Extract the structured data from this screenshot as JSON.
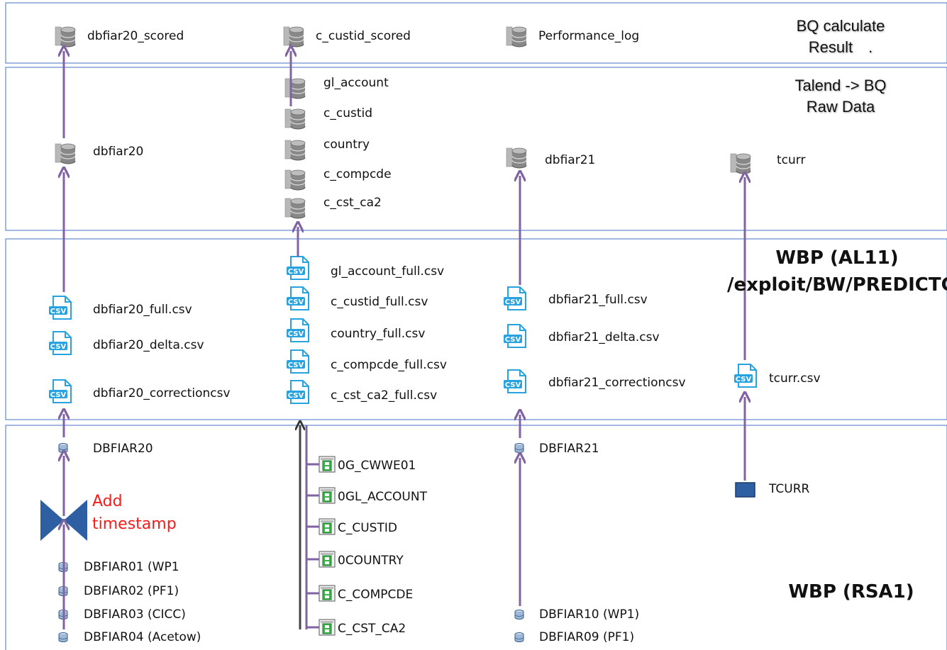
{
  "zones": {
    "bq_result": {
      "line1": "BQ calculate",
      "line2": "Result",
      "dot": "."
    },
    "bq_raw": {
      "line1": "Talend -> BQ",
      "line2": "Raw Data"
    },
    "al11": {
      "line1": "WBP (AL11)",
      "line2": "/exploit/BW/PREDICTCM"
    },
    "rsa1": {
      "line1": "WBP (RSA1)"
    }
  },
  "annotation": {
    "line1": "Add",
    "line2": "timestamp"
  },
  "bq_scored": [
    "dbfiar20_scored",
    "c_custid_scored",
    "Performance_log"
  ],
  "bq_raw_tables": {
    "col1": [
      "dbfiar20"
    ],
    "col2": [
      "gl_account",
      "c_custid",
      "country",
      "c_compcde",
      "c_cst_ca2"
    ],
    "col3": [
      "dbfiar21"
    ],
    "col4": [
      "tcurr"
    ]
  },
  "csv_files": {
    "col1": [
      "dbfiar20_full.csv",
      "dbfiar20_delta.csv",
      "dbfiar20_correctioncsv"
    ],
    "col2": [
      "gl_account_full.csv",
      "c_custid_full.csv",
      "country_full.csv",
      "c_compcde_full.csv",
      "c_cst_ca2_full.csv"
    ],
    "col3": [
      "dbfiar21_full.csv",
      "dbfiar21_delta.csv",
      "dbfiar21_correctioncsv"
    ],
    "col4": [
      "tcurr.csv"
    ]
  },
  "rsa1_sources": {
    "col1_top": "DBFIAR20",
    "col1_bottom": [
      "DBFIAR01 (WP1",
      "DBFIAR02 (PF1)",
      "DBFIAR03 (CICC)",
      "DBFIAR04 (Acetow)"
    ],
    "col2": [
      "0G_CWWE01",
      "0GL_ACCOUNT",
      "C_CUSTID",
      "0COUNTRY",
      "C_COMPCDE",
      "C_CST_CA2"
    ],
    "col3_top": "DBFIAR21",
    "col3_bottom": [
      "DBFIAR10 (WP1)",
      "DBFIAR09 (PF1)"
    ],
    "col4": "TCURR"
  },
  "icons": {
    "db": "sql-server-database-icon",
    "csv": "csv-file-icon",
    "cube": "bw-cube-icon",
    "table": "bw-table-icon",
    "transform": "bowtie-transformation-icon"
  },
  "colors": {
    "arrow": "#8064a2",
    "zone_border": "#4472c4",
    "csv_icon": "#29a3e0",
    "annotation": "#ff1a1a",
    "transform": "#2e5fa3"
  }
}
